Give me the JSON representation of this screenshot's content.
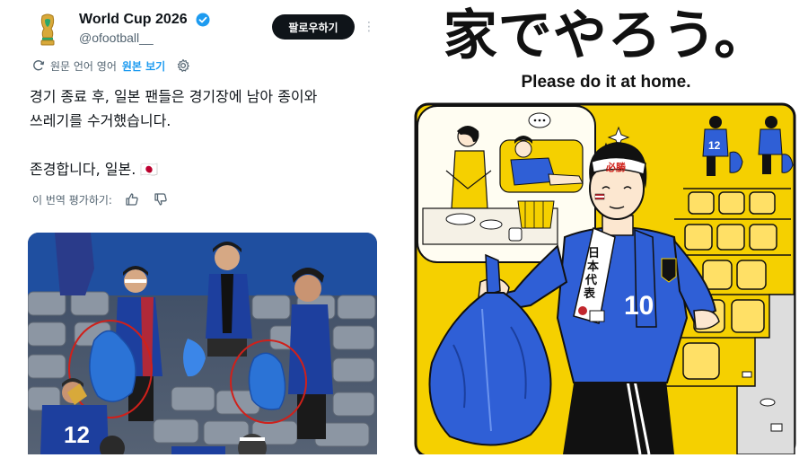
{
  "tweet": {
    "display_name": "World Cup 2026",
    "handle": "@ofootball__",
    "follow_label": "팔로우하기",
    "translation_note": "원문 언어 영어",
    "show_original_label": "원본 보기",
    "text": "경기 종료 후, 일본 팬들은 경기장에 남아 종이와\n쓰레기를 수거했습니다.\n\n존경합니다, 일본. 🇯🇵",
    "rate_translation_label": "이 번역 평가하기:"
  },
  "photo": {
    "jersey_number": "12"
  },
  "poster": {
    "title": "家でやろう。",
    "subtitle": "Please do it at home.",
    "headband_text": "必勝",
    "scarf_text": "日本代表",
    "jersey_number": "10",
    "background_player_number": "12",
    "colors": {
      "yellow": "#f5d000",
      "blue": "#2f5fd6",
      "dark": "#111111"
    }
  },
  "icons": {
    "verified": "verified-badge-icon",
    "more": "more-options-icon",
    "translate": "translate-icon",
    "settings": "gear-icon",
    "thumbs_up": "thumbs-up-icon",
    "thumbs_down": "thumbs-down-icon"
  }
}
